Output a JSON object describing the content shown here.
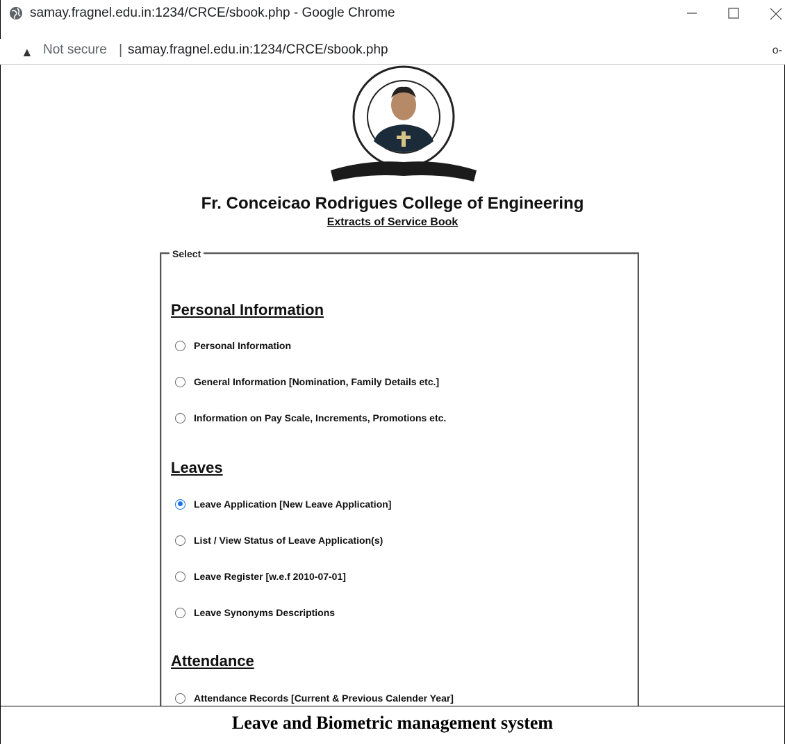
{
  "browser": {
    "window_title": "samay.fragnel.edu.in:1234/CRCE/sbook.php - Google Chrome",
    "security_label": "Not secure",
    "url": "samay.fragnel.edu.in:1234/CRCE/sbook.php",
    "icons": [
      "globe-icon",
      "minimize-icon",
      "maximize-icon",
      "close-icon",
      "warning-icon",
      "key-icon"
    ]
  },
  "header": {
    "logo_icon": "college-crest-logo",
    "college_name": "Fr. Conceicao Rodrigues College of Engineering",
    "subtitle": "Extracts of Service Book"
  },
  "form": {
    "legend": "Select",
    "sections": [
      {
        "heading": "Personal Information",
        "options": [
          {
            "label": "Personal Information",
            "checked": false
          },
          {
            "label": "General Information [Nomination, Family Details etc.]",
            "checked": false
          },
          {
            "label": "Information on Pay Scale, Increments, Promotions etc.",
            "checked": false
          }
        ]
      },
      {
        "heading": "Leaves",
        "options": [
          {
            "label": "Leave Application [New Leave Application]",
            "checked": true
          },
          {
            "label": "List / View Status of Leave Application(s)",
            "checked": false
          },
          {
            "label": "Leave Register [w.e.f 2010-07-01]",
            "checked": false
          },
          {
            "label": "Leave Synonyms Descriptions",
            "checked": false
          }
        ]
      },
      {
        "heading": "Attendance",
        "options": [
          {
            "label": "Attendance Records [Current & Previous Calender Year]",
            "checked": false
          }
        ]
      }
    ]
  },
  "caption": "Leave and Biometric management system",
  "colors": {
    "radio_checked": "#1a73e8",
    "text": "#111111"
  }
}
